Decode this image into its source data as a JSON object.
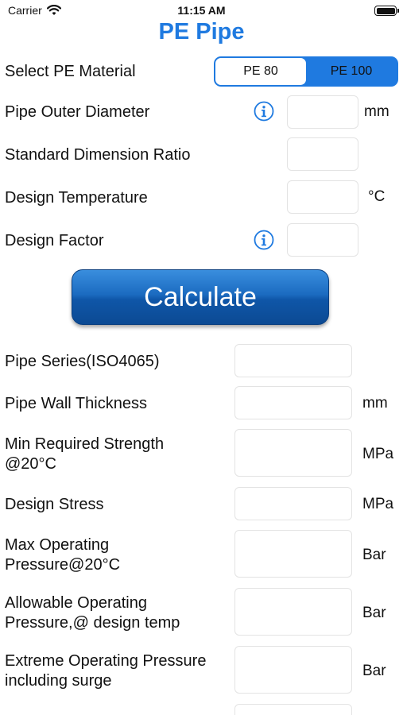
{
  "status": {
    "carrier": "Carrier",
    "time": "11:15 AM"
  },
  "app": {
    "title": "PE Pipe"
  },
  "material": {
    "label": "Select PE Material",
    "options": [
      "PE 80",
      "PE 100"
    ],
    "selected": "PE 80"
  },
  "inputs": {
    "outer_diameter": {
      "label": "Pipe Outer Diameter",
      "unit": "mm",
      "value": ""
    },
    "sdr": {
      "label": "Standard Dimension Ratio",
      "value": ""
    },
    "design_temp": {
      "label": "Design Temperature",
      "unit": "°C",
      "value": ""
    },
    "design_factor": {
      "label": "Design Factor",
      "value": ""
    }
  },
  "calculate_label": "Calculate",
  "results": {
    "pipe_series": {
      "label": "Pipe Series(ISO4065)"
    },
    "wall_thickness": {
      "label": "Pipe Wall Thickness",
      "unit": "mm"
    },
    "mrs": {
      "line1": "Min Required Strength",
      "line2": "@20°C",
      "unit": "MPa"
    },
    "design_stress": {
      "label": "Design Stress",
      "unit": "MPa"
    },
    "max_op_pressure": {
      "line1": "Max Operating",
      "line2": "Pressure@20°C",
      "unit": "Bar"
    },
    "allow_op_pressure": {
      "line1": "Allowable Operating",
      "line2": "Pressure,@ design temp",
      "unit": "Bar"
    },
    "extreme_op_pressure": {
      "line1": "Extreme Operating Pressure",
      "line2": "including surge",
      "unit": "Bar"
    }
  },
  "colors": {
    "accent": "#1f7ae0",
    "button": "#1b6bc0"
  },
  "icons": [
    "wifi-icon",
    "battery-icon",
    "info-icon"
  ]
}
